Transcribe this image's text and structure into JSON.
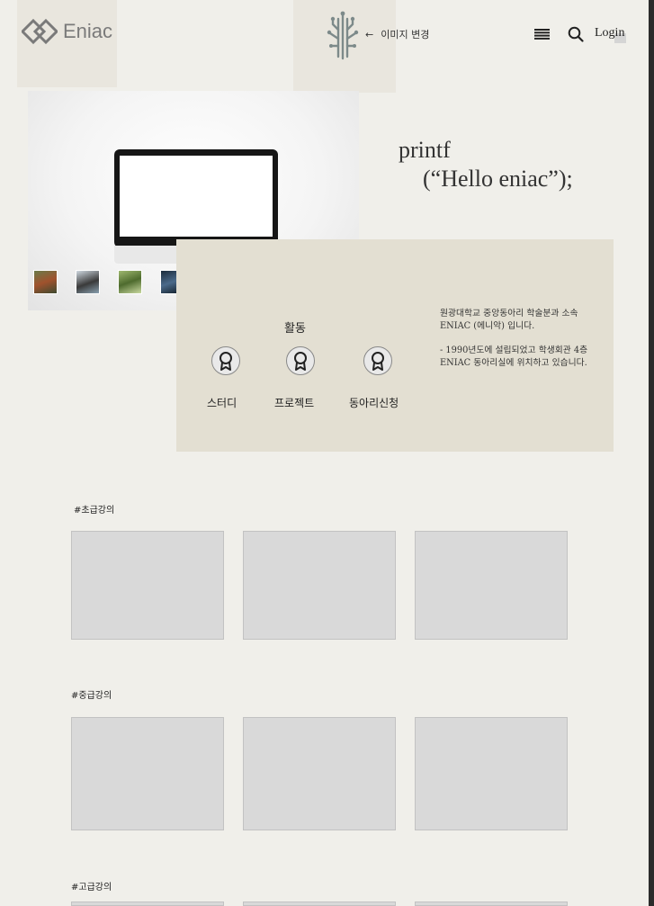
{
  "header": {
    "brand": "Eniac",
    "change_image": "이미지 변경",
    "login": "Login"
  },
  "hero": {
    "code_line1": "printf",
    "code_line2": "(“Hello eniac”);"
  },
  "activities": {
    "title": "활동",
    "items": [
      "스터디",
      "프로젝트",
      "동아리신청"
    ]
  },
  "about": {
    "line1": "원광대학교 중앙동아리 학술분과 소속",
    "line2": "ENIAC (에니악) 입니다.",
    "line3": "- 1990년도에 설립되었고 학생회관 4층",
    "line4": "ENIAC 동아리실에 위치하고 있습니다."
  },
  "sections": [
    {
      "title": "#초급강의"
    },
    {
      "title": "#중급강의"
    },
    {
      "title": "#고급강의"
    }
  ],
  "colors": {
    "page_bg": "#f0efea",
    "panel_bg": "#e3dfd2",
    "card_bg": "#d9d9d9",
    "logo_gray": "#7a7a7a",
    "tree_icon": "#7d8a8a"
  }
}
